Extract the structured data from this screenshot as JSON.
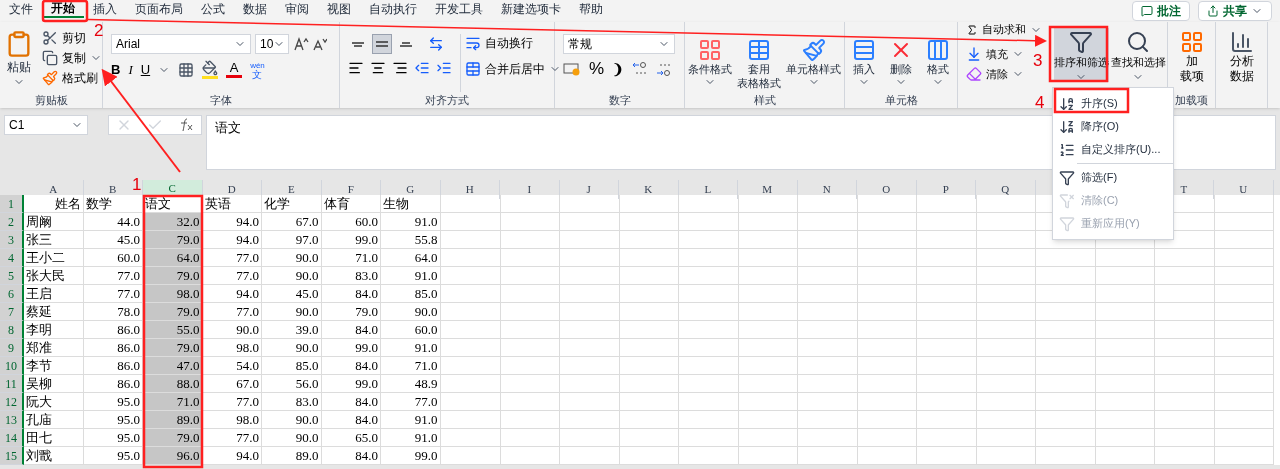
{
  "menu_tabs": [
    {
      "label": "文件",
      "selected": false
    },
    {
      "label": "开始",
      "selected": true
    },
    {
      "label": "插入",
      "selected": false
    },
    {
      "label": "页面布局",
      "selected": false
    },
    {
      "label": "公式",
      "selected": false
    },
    {
      "label": "数据",
      "selected": false
    },
    {
      "label": "审阅",
      "selected": false
    },
    {
      "label": "视图",
      "selected": false
    },
    {
      "label": "自动执行",
      "selected": false
    },
    {
      "label": "开发工具",
      "selected": false
    },
    {
      "label": "新建选项卡",
      "selected": false
    },
    {
      "label": "帮助",
      "selected": false
    }
  ],
  "top_buttons": [
    {
      "kind": "comment",
      "label": "批注"
    },
    {
      "kind": "share",
      "label": "共享"
    }
  ],
  "ribbon": [
    {
      "kind": "clipboard",
      "label": "剪贴板",
      "paste": "粘贴",
      "cut": "剪切",
      "copy": "复制",
      "format_painter": "格式刷"
    },
    {
      "kind": "font",
      "label": "字体",
      "font_name": "Arial",
      "font_size": "10",
      "bold": "B",
      "italic": "I",
      "underline": "U",
      "font_color": "A",
      "phonetic_top": "wén",
      "phonetic_bottom": "文"
    },
    {
      "kind": "alignment",
      "label": "对齐方式",
      "valign": [
        {
          "selected": false
        },
        {
          "selected": true
        },
        {
          "selected": false
        }
      ],
      "wrap": "自动换行",
      "merge": "合并后居中"
    },
    {
      "kind": "number",
      "label": "数字",
      "format": "常规",
      "percent": "%",
      "comma": "❩"
    },
    {
      "kind": "styles",
      "label": "样式",
      "conditional": "条件格式",
      "table_top": "套用",
      "table_bottom": "表格格式",
      "cell_styles": "单元格样式"
    },
    {
      "kind": "cells",
      "label": "单元格",
      "insert": "插入",
      "delete": "删除",
      "format": "格式"
    },
    {
      "kind": "editing",
      "autosum": "自动求和",
      "fill": "填充",
      "clear": "清除",
      "sort": "排序和筛选",
      "find": "查找和选择"
    },
    {
      "kind": "addins",
      "label": "加载项",
      "top": "加",
      "bottom": "载项"
    },
    {
      "kind": "analysis",
      "top": "分析",
      "bottom": "数据"
    }
  ],
  "sort_menu": [
    {
      "kind": "asc",
      "label": "升序(S)",
      "disabled": false
    },
    {
      "kind": "desc",
      "label": "降序(O)",
      "disabled": false
    },
    {
      "kind": "custom",
      "label": "自定义排序(U)...",
      "disabled": false
    },
    {
      "kind": "filter",
      "label": "筛选(F)",
      "disabled": false
    },
    {
      "kind": "clear",
      "label": "清除(C)",
      "disabled": true
    },
    {
      "kind": "reapply",
      "label": "重新应用(Y)",
      "disabled": true
    }
  ],
  "formula_bar": {
    "name_box": "C1",
    "formula": "语文"
  },
  "columns": [
    {
      "label": "A",
      "selected": false
    },
    {
      "label": "B",
      "selected": false
    },
    {
      "label": "C",
      "selected": true
    },
    {
      "label": "D",
      "selected": false
    },
    {
      "label": "E",
      "selected": false
    },
    {
      "label": "F",
      "selected": false
    },
    {
      "label": "G",
      "selected": false
    },
    {
      "label": "H",
      "selected": false
    },
    {
      "label": "I",
      "selected": false
    },
    {
      "label": "J",
      "selected": false
    },
    {
      "label": "K",
      "selected": false
    },
    {
      "label": "L",
      "selected": false
    },
    {
      "label": "M",
      "selected": false
    },
    {
      "label": "N",
      "selected": false
    },
    {
      "label": "O",
      "selected": false
    },
    {
      "label": "P",
      "selected": false
    },
    {
      "label": "Q",
      "selected": false
    },
    {},
    {},
    {
      "label": "T",
      "selected": false
    },
    {
      "label": "U",
      "selected": false
    }
  ],
  "rows": [
    {
      "number": "1",
      "kind": "header",
      "selected": true,
      "cells": [
        "姓名",
        "数学",
        "语文",
        "英语",
        "化学",
        "体育",
        "生物"
      ]
    },
    {
      "number": "2",
      "kind": "data",
      "selected": true,
      "cells": [
        "周阚",
        "44.0",
        "32.0",
        "94.0",
        "67.0",
        "60.0",
        "91.0"
      ]
    },
    {
      "number": "3",
      "kind": "data",
      "selected": true,
      "cells": [
        "张三",
        "45.0",
        "79.0",
        "94.0",
        "97.0",
        "99.0",
        "55.8"
      ]
    },
    {
      "number": "4",
      "kind": "data",
      "selected": true,
      "cells": [
        "王小二",
        "60.0",
        "64.0",
        "77.0",
        "90.0",
        "71.0",
        "64.0"
      ]
    },
    {
      "number": "5",
      "kind": "data",
      "selected": true,
      "cells": [
        "张大民",
        "77.0",
        "79.0",
        "77.0",
        "90.0",
        "83.0",
        "91.0"
      ]
    },
    {
      "number": "6",
      "kind": "data",
      "selected": true,
      "cells": [
        "王启",
        "77.0",
        "98.0",
        "94.0",
        "45.0",
        "84.0",
        "85.0"
      ]
    },
    {
      "number": "7",
      "kind": "data",
      "selected": true,
      "cells": [
        "蔡延",
        "78.0",
        "79.0",
        "77.0",
        "90.0",
        "79.0",
        "90.0"
      ]
    },
    {
      "number": "8",
      "kind": "data",
      "selected": true,
      "cells": [
        "李明",
        "86.0",
        "55.0",
        "90.0",
        "39.0",
        "84.0",
        "60.0"
      ]
    },
    {
      "number": "9",
      "kind": "data",
      "selected": true,
      "cells": [
        "郑准",
        "86.0",
        "79.0",
        "98.0",
        "90.0",
        "99.0",
        "91.0"
      ]
    },
    {
      "number": "10",
      "kind": "data",
      "selected": true,
      "cells": [
        "李节",
        "86.0",
        "47.0",
        "54.0",
        "85.0",
        "84.0",
        "71.0"
      ]
    },
    {
      "number": "11",
      "kind": "data",
      "selected": true,
      "cells": [
        "吴柳",
        "86.0",
        "88.0",
        "67.0",
        "56.0",
        "99.0",
        "48.9"
      ]
    },
    {
      "number": "12",
      "kind": "data",
      "selected": true,
      "cells": [
        "阮大",
        "95.0",
        "71.0",
        "77.0",
        "83.0",
        "84.0",
        "77.0"
      ]
    },
    {
      "number": "13",
      "kind": "data",
      "selected": true,
      "cells": [
        "孔庙",
        "95.0",
        "89.0",
        "98.0",
        "90.0",
        "84.0",
        "91.0"
      ]
    },
    {
      "number": "14",
      "kind": "data",
      "selected": true,
      "cells": [
        "田七",
        "95.0",
        "79.0",
        "77.0",
        "90.0",
        "65.0",
        "91.0"
      ]
    },
    {
      "number": "15",
      "kind": "data",
      "selected": true,
      "cells": [
        "刘戬",
        "95.0",
        "96.0",
        "94.0",
        "89.0",
        "84.0",
        "99.0"
      ]
    }
  ],
  "annotations": [
    {
      "label": "1"
    },
    {
      "label": "2"
    },
    {
      "label": "3"
    },
    {
      "label": "4"
    }
  ]
}
